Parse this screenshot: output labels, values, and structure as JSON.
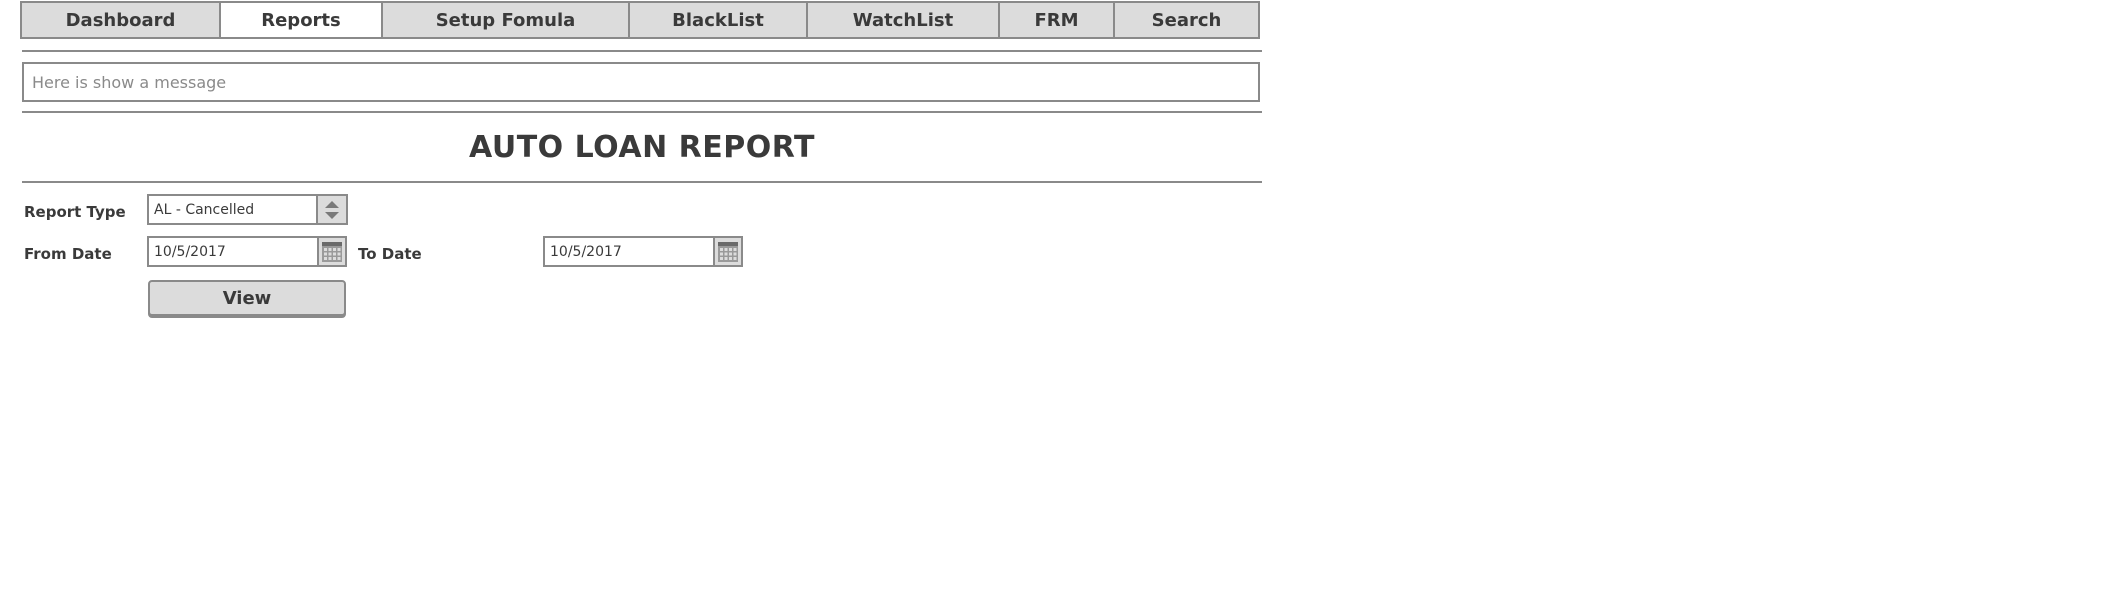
{
  "tabs": [
    {
      "label": "Dashboard",
      "active": false
    },
    {
      "label": "Reports",
      "active": true
    },
    {
      "label": "Setup Fomula",
      "active": false
    },
    {
      "label": "BlackList",
      "active": false
    },
    {
      "label": "WatchList",
      "active": false
    },
    {
      "label": "FRM",
      "active": false
    },
    {
      "label": "Search",
      "active": false
    }
  ],
  "message": {
    "text": "Here is show a message"
  },
  "page": {
    "title": "AUTO LOAN REPORT"
  },
  "form": {
    "report_type_label": "Report Type",
    "report_type_value": "AL - Cancelled",
    "from_date_label": "From Date",
    "from_date_value": "10/5/2017",
    "to_date_label": "To Date",
    "to_date_value": "10/5/2017",
    "view_label": "View"
  },
  "icons": {
    "report_type_addon": "up-down-arrows-icon",
    "date_addon": "calendar-icon"
  },
  "colors": {
    "border": "#8a8a8a",
    "tab_background": "#dcdcdc",
    "active_tab_background": "#ffffff",
    "text": "#3a3a3a",
    "placeholder_text": "#8a8a8a"
  }
}
